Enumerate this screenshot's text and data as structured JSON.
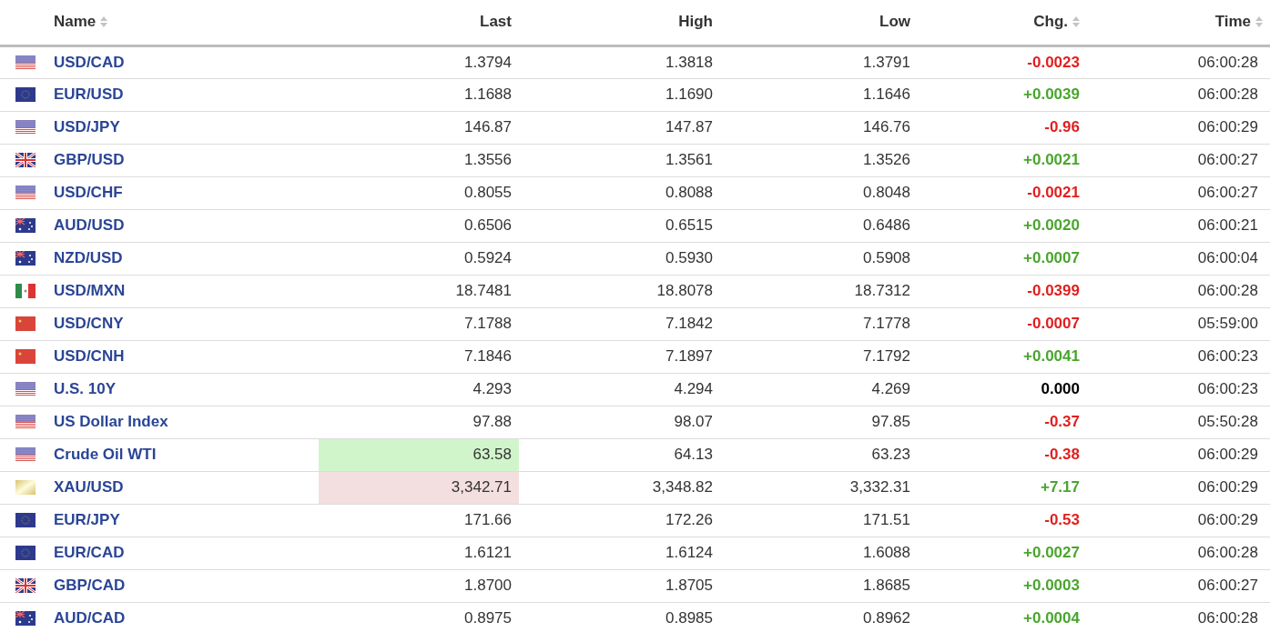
{
  "table": {
    "columns": [
      {
        "label": "Name",
        "sortable": true
      },
      {
        "label": "Last",
        "sortable": false
      },
      {
        "label": "High",
        "sortable": false
      },
      {
        "label": "Low",
        "sortable": false
      },
      {
        "label": "Chg.",
        "sortable": true
      },
      {
        "label": "Time",
        "sortable": true
      }
    ],
    "rows": [
      {
        "flag": {
          "kind": "us"
        },
        "name": "USD/CAD",
        "last": "1.3794",
        "high": "1.3818",
        "low": "1.3791",
        "chg": "-0.0023",
        "color": "#e02020",
        "time": "06:00:28"
      },
      {
        "flag": {
          "kind": "eu"
        },
        "name": "EUR/USD",
        "last": "1.1688",
        "high": "1.1690",
        "low": "1.1646",
        "chg": "+0.0039",
        "color": "#4aa52e",
        "time": "06:00:28"
      },
      {
        "flag": {
          "kind": "us"
        },
        "name": "USD/JPY",
        "last": "146.87",
        "high": "147.87",
        "low": "146.76",
        "chg": "-0.96",
        "color": "#e02020",
        "time": "06:00:29"
      },
      {
        "flag": {
          "kind": "gb"
        },
        "name": "GBP/USD",
        "last": "1.3556",
        "high": "1.3561",
        "low": "1.3526",
        "chg": "+0.0021",
        "color": "#4aa52e",
        "time": "06:00:27"
      },
      {
        "flag": {
          "kind": "us"
        },
        "name": "USD/CHF",
        "last": "0.8055",
        "high": "0.8088",
        "low": "0.8048",
        "chg": "-0.0021",
        "color": "#e02020",
        "time": "06:00:27"
      },
      {
        "flag": {
          "kind": "au"
        },
        "name": "AUD/USD",
        "last": "0.6506",
        "high": "0.6515",
        "low": "0.6486",
        "chg": "+0.0020",
        "color": "#4aa52e",
        "time": "06:00:21"
      },
      {
        "flag": {
          "kind": "nz"
        },
        "name": "NZD/USD",
        "last": "0.5924",
        "high": "0.5930",
        "low": "0.5908",
        "chg": "+0.0007",
        "color": "#4aa52e",
        "time": "06:00:04"
      },
      {
        "flag": {
          "kind": "mx"
        },
        "name": "USD/MXN",
        "last": "18.7481",
        "high": "18.8078",
        "low": "18.7312",
        "chg": "-0.0399",
        "color": "#e02020",
        "time": "06:00:28"
      },
      {
        "flag": {
          "kind": "cn"
        },
        "name": "USD/CNY",
        "last": "7.1788",
        "high": "7.1842",
        "low": "7.1778",
        "chg": "-0.0007",
        "color": "#e02020",
        "time": "05:59:00"
      },
      {
        "flag": {
          "kind": "cn"
        },
        "name": "USD/CNH",
        "last": "7.1846",
        "high": "7.1897",
        "low": "7.1792",
        "chg": "+0.0041",
        "color": "#4aa52e",
        "time": "06:00:23"
      },
      {
        "flag": {
          "kind": "us"
        },
        "name": "U.S. 10Y",
        "last": "4.293",
        "high": "4.294",
        "low": "4.269",
        "chg": "0.000",
        "color": "#000000",
        "time": "06:00:23"
      },
      {
        "flag": {
          "kind": "us"
        },
        "name": "US Dollar Index",
        "last": "97.88",
        "high": "98.07",
        "low": "97.85",
        "chg": "-0.37",
        "color": "#e02020",
        "time": "05:50:28"
      },
      {
        "flag": {
          "kind": "us"
        },
        "name": "Crude Oil WTI",
        "last": "63.58",
        "flash": {
          "kind": "up"
        },
        "high": "64.13",
        "low": "63.23",
        "chg": "-0.38",
        "color": "#e02020",
        "time": "06:00:29"
      },
      {
        "flag": {
          "kind": "gold"
        },
        "name": "XAU/USD",
        "last": "3,342.71",
        "flash": {
          "kind": "down"
        },
        "high": "3,348.82",
        "low": "3,332.31",
        "chg": "+7.17",
        "color": "#4aa52e",
        "time": "06:00:29"
      },
      {
        "flag": {
          "kind": "eu"
        },
        "name": "EUR/JPY",
        "last": "171.66",
        "high": "172.26",
        "low": "171.51",
        "chg": "-0.53",
        "color": "#e02020",
        "time": "06:00:29"
      },
      {
        "flag": {
          "kind": "eu"
        },
        "name": "EUR/CAD",
        "last": "1.6121",
        "high": "1.6124",
        "low": "1.6088",
        "chg": "+0.0027",
        "color": "#4aa52e",
        "time": "06:00:28"
      },
      {
        "flag": {
          "kind": "gb"
        },
        "name": "GBP/CAD",
        "last": "1.8700",
        "high": "1.8705",
        "low": "1.8685",
        "chg": "+0.0003",
        "color": "#4aa52e",
        "time": "06:00:27"
      },
      {
        "flag": {
          "kind": "au"
        },
        "name": "AUD/CAD",
        "last": "0.8975",
        "high": "0.8985",
        "low": "0.8962",
        "chg": "+0.0004",
        "color": "#4aa52e",
        "time": "06:00:28"
      }
    ]
  }
}
